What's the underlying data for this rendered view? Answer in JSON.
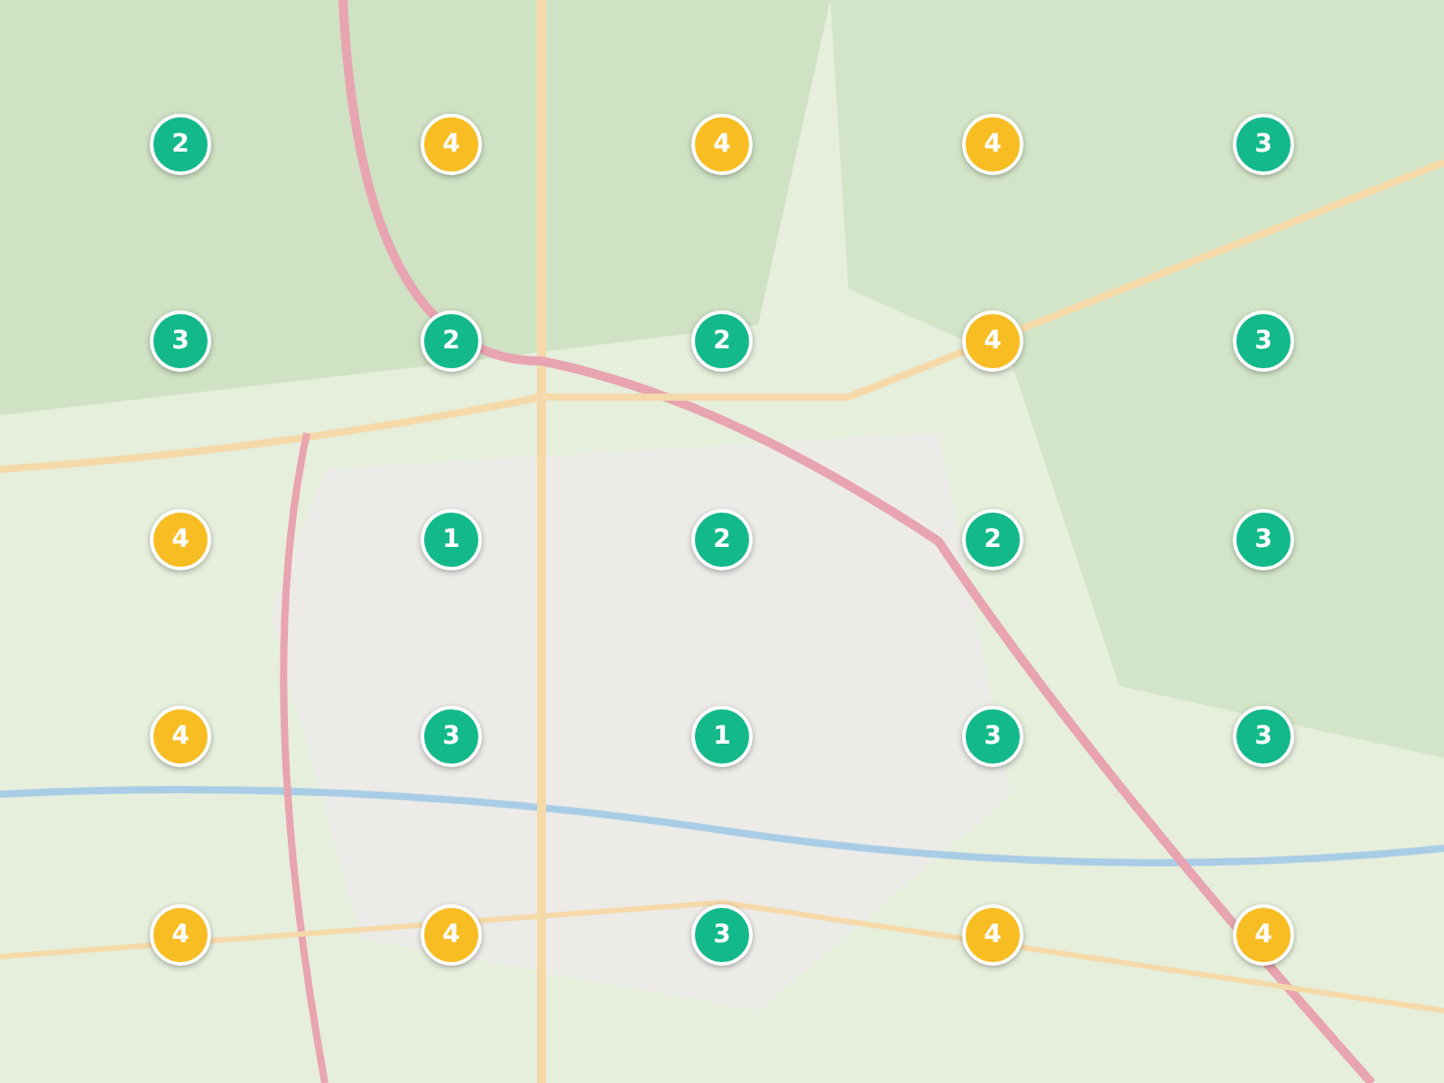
{
  "map": {
    "markers": [
      {
        "count": "2",
        "color": "#13b98a"
      },
      {
        "count": "4",
        "color": "#f8bd22"
      },
      {
        "count": "4",
        "color": "#f8bd22"
      },
      {
        "count": "4",
        "color": "#f8bd22"
      },
      {
        "count": "3",
        "color": "#13b98a"
      },
      {
        "count": "3",
        "color": "#13b98a"
      },
      {
        "count": "2",
        "color": "#13b98a"
      },
      {
        "count": "2",
        "color": "#13b98a"
      },
      {
        "count": "4",
        "color": "#f8bd22"
      },
      {
        "count": "3",
        "color": "#13b98a"
      },
      {
        "count": "4",
        "color": "#f8bd22"
      },
      {
        "count": "1",
        "color": "#13b98a"
      },
      {
        "count": "2",
        "color": "#13b98a"
      },
      {
        "count": "2",
        "color": "#13b98a"
      },
      {
        "count": "3",
        "color": "#13b98a"
      },
      {
        "count": "4",
        "color": "#f8bd22"
      },
      {
        "count": "3",
        "color": "#13b98a"
      },
      {
        "count": "1",
        "color": "#13b98a"
      },
      {
        "count": "3",
        "color": "#13b98a"
      },
      {
        "count": "3",
        "color": "#13b98a"
      },
      {
        "count": "4",
        "color": "#f8bd22"
      },
      {
        "count": "4",
        "color": "#f8bd22"
      },
      {
        "count": "3",
        "color": "#13b98a"
      },
      {
        "count": "4",
        "color": "#f8bd22"
      },
      {
        "count": "4",
        "color": "#f8bd22"
      }
    ]
  }
}
